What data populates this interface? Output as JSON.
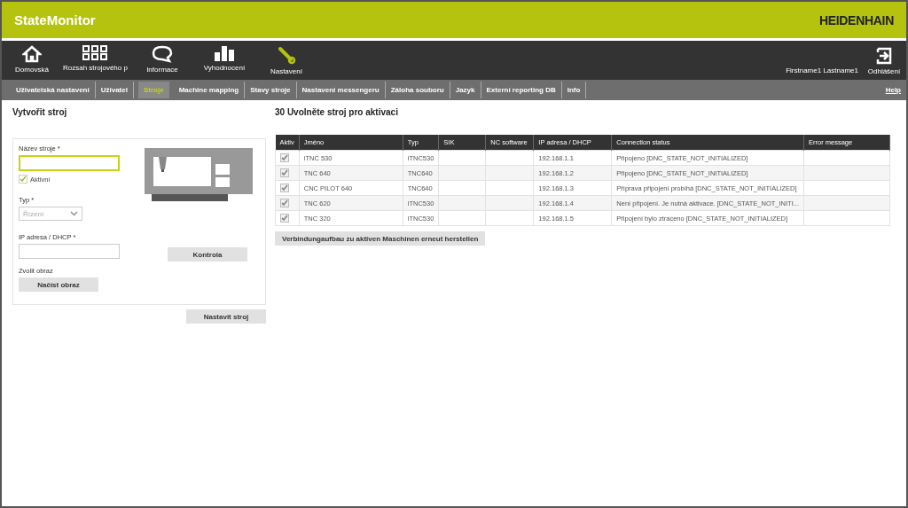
{
  "header": {
    "app_title": "StateMonitor",
    "brand": "HEIDENHAIN"
  },
  "nav": [
    {
      "label": "Domovská",
      "kind": "home",
      "selected": false
    },
    {
      "label": "Rozsah strojového p",
      "kind": "grid",
      "selected": false
    },
    {
      "label": "Informace",
      "kind": "info",
      "selected": false
    },
    {
      "label": "Vyhodnocení",
      "kind": "chart",
      "selected": false
    },
    {
      "label": "Nastavení",
      "kind": "settings",
      "selected": true
    }
  ],
  "user": {
    "name": "Firstname1 Lastname1",
    "logout": "Odhlášení"
  },
  "tabs": [
    {
      "label": "Uživatelská nastavení",
      "selected": false
    },
    {
      "label": "Uživatel",
      "selected": false
    },
    {
      "label": "Stroje",
      "selected": true
    },
    {
      "label": "Machine mapping",
      "selected": false
    },
    {
      "label": "Stavy stroje",
      "selected": false
    },
    {
      "label": "Nastavení messengeru",
      "selected": false
    },
    {
      "label": "Záloha souboru",
      "selected": false
    },
    {
      "label": "Jazyk",
      "selected": false
    },
    {
      "label": "Externí reporting DB",
      "selected": false
    },
    {
      "label": "Info",
      "selected": false
    }
  ],
  "help": "Help",
  "create": {
    "title": "Vytvořit stroj",
    "name_label": "Název stroje *",
    "active_label": "Aktivní",
    "active_checked": true,
    "type_label": "Typ *",
    "type_value": "Řízení",
    "ip_label": "IP adresa / DHCP *",
    "check_button": "Kontrola",
    "image_label": "Zvolit obraz",
    "load_image_button": "Načíst obraz",
    "submit_button": "Nastavit stroj"
  },
  "machines": {
    "title": "30 Uvolněte stroj pro aktivaci",
    "columns": [
      "Aktiv",
      "Jméno",
      "Typ",
      "SIK",
      "NC software",
      "IP adresa / DHCP",
      "Connection status",
      "Error message"
    ],
    "rows": [
      {
        "checked": true,
        "name": "iTNC 530",
        "type": "iTNC530",
        "ip": "192.168.1.1",
        "status": "Připojeno [DNC_STATE_NOT_INITIALIZED]"
      },
      {
        "checked": true,
        "name": "TNC 640",
        "type": "TNC640",
        "ip": "192.168.1.2",
        "status": "Připojeno [DNC_STATE_NOT_INITIALIZED]"
      },
      {
        "checked": true,
        "name": "CNC PILOT 640",
        "type": "TNC640",
        "ip": "192.168.1.3",
        "status": "Příprava připojení probíhá [DNC_STATE_NOT_INITIALIZED]"
      },
      {
        "checked": true,
        "name": "TNC 620",
        "type": "iTNC530",
        "ip": "192.168.1.4",
        "status": "Není připojení. Je nutná aktivace. [DNC_STATE_NOT_INITI..."
      },
      {
        "checked": true,
        "name": "TNC 320",
        "type": "iTNC530",
        "ip": "192.168.1.5",
        "status": "Připojení bylo ztraceno [DNC_STATE_NOT_INITIALIZED]"
      }
    ],
    "reconnect_button": "Verbindungaufbau zu aktiven Maschinen erneut herstellen"
  }
}
